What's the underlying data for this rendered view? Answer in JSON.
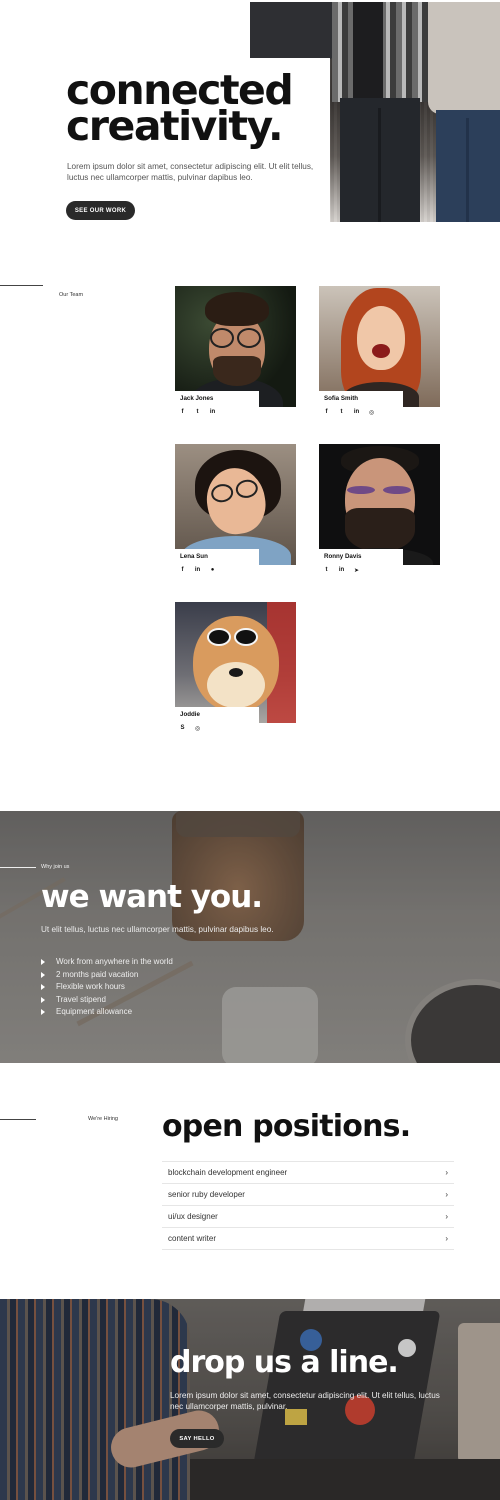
{
  "hero": {
    "title_line1": "connected",
    "title_line2": "creativity.",
    "subtitle": "Lorem ipsum dolor sit amet, consectetur adipiscing elit. Ut elit tellus, luctus nec ullamcorper mattis, pulvinar dapibus leo.",
    "cta_label": "SEE OUR WORK"
  },
  "team": {
    "label": "Our Team",
    "members": [
      {
        "name": "Jack Jones",
        "social": [
          "facebook-icon",
          "twitter-icon",
          "linkedin-icon"
        ]
      },
      {
        "name": "Sofia Smith",
        "social": [
          "facebook-icon",
          "twitter-icon",
          "linkedin-icon",
          "instagram-icon"
        ]
      },
      {
        "name": "Lena Sun",
        "social": [
          "facebook-icon",
          "linkedin-icon",
          "github-icon"
        ]
      },
      {
        "name": "Ronny Davis",
        "social": [
          "twitter-icon",
          "linkedin-icon",
          "telegram-icon"
        ]
      },
      {
        "name": "Joddie",
        "social": [
          "skype-icon",
          "instagram-icon"
        ]
      }
    ]
  },
  "why": {
    "label": "Why join us",
    "title": "we want you.",
    "subtitle": "Ut elit tellus, luctus nec ullamcorper mattis, pulvinar dapibus leo.",
    "perks": [
      "Work from anywhere in the world",
      "2 months paid vacation",
      "Flexible work hours",
      "Travel stipend",
      "Equipment allowance"
    ]
  },
  "positions": {
    "label": "We're Hiring",
    "title": "open positions.",
    "items": [
      "blockchain development engineer",
      "senior ruby developer",
      "ui/ux designer",
      "content writer"
    ]
  },
  "contact": {
    "title": "drop us a line.",
    "subtitle": "Lorem ipsum dolor sit amet, consectetur adipiscing elit. Ut elit tellus, luctus nec ullamcorper mattis, pulvinar.",
    "cta_label": "SAY HELLO"
  },
  "icon_glyphs": {
    "facebook-icon": "f",
    "twitter-icon": "t",
    "linkedin-icon": "in",
    "instagram-icon": "◎",
    "github-icon": "●",
    "telegram-icon": "➤",
    "skype-icon": "S"
  },
  "colors": {
    "dark_button": "#2a2a2a",
    "text_primary": "#111111"
  }
}
